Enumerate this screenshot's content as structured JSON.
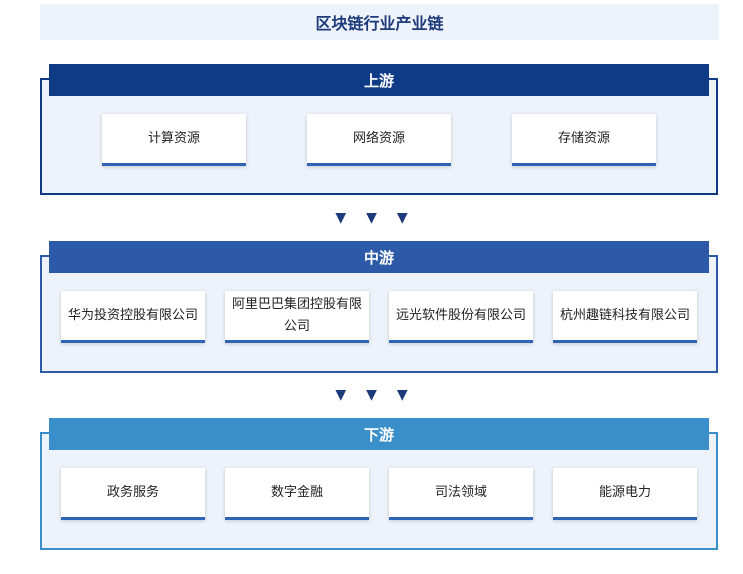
{
  "title": "区块链行业产业链",
  "upstream": {
    "label": "上游",
    "items": [
      "计算资源",
      "网络资源",
      "存储资源"
    ]
  },
  "midstream": {
    "label": "中游",
    "items": [
      "华为投资控股有限公司",
      "阿里巴巴集团控股有限公司",
      "远光软件股份有限公司",
      "杭州趣链科技有限公司"
    ]
  },
  "downstream": {
    "label": "下游",
    "items": [
      "政务服务",
      "数字金融",
      "司法领域",
      "能源电力"
    ]
  },
  "arrow_glyph": "▼",
  "colors": {
    "upstream": "#0e3a86",
    "midstream": "#2d5aa8",
    "downstream": "#3a8ec9",
    "card_border": "#2f64b5"
  }
}
